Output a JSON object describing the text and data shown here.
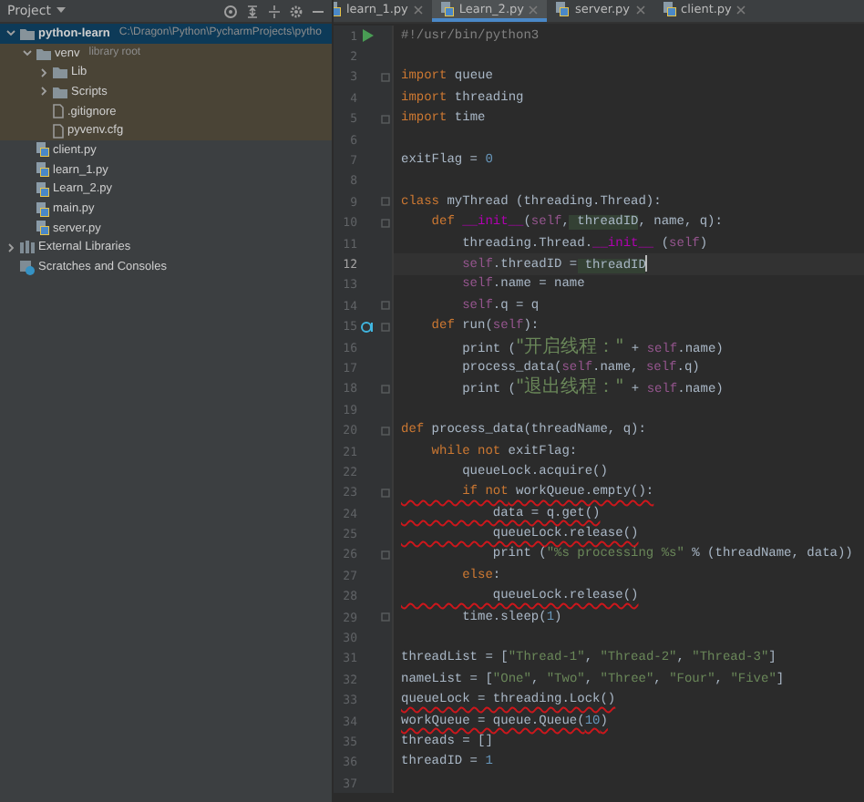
{
  "project_panel": {
    "title": "Project",
    "tree": [
      {
        "label": "python-learn",
        "note": "C:\\Dragon\\Python\\PycharmProjects\\pytho",
        "kind": "root",
        "expanded": true,
        "selected": true,
        "highlighted": false,
        "children": [
          {
            "label": "venv",
            "note": "library root",
            "kind": "folder",
            "expanded": true,
            "selected": false,
            "highlighted": true,
            "children": [
              {
                "label": "Lib",
                "kind": "folder",
                "expanded": false,
                "selected": false,
                "highlighted": true
              },
              {
                "label": "Scripts",
                "kind": "folder",
                "expanded": false,
                "selected": false,
                "highlighted": true
              },
              {
                "label": ".gitignore",
                "kind": "file",
                "selected": false,
                "highlighted": true
              },
              {
                "label": "pyvenv.cfg",
                "kind": "file",
                "selected": false,
                "highlighted": true
              }
            ]
          },
          {
            "label": "client.py",
            "kind": "python",
            "selected": false,
            "highlighted": false
          },
          {
            "label": "learn_1.py",
            "kind": "python",
            "selected": false,
            "highlighted": false
          },
          {
            "label": "Learn_2.py",
            "kind": "python",
            "selected": false,
            "highlighted": false
          },
          {
            "label": "main.py",
            "kind": "python",
            "selected": false,
            "highlighted": false
          },
          {
            "label": "server.py",
            "kind": "python",
            "selected": false,
            "highlighted": false
          }
        ]
      },
      {
        "label": "External Libraries",
        "kind": "library",
        "expanded": false,
        "selected": false,
        "highlighted": false
      },
      {
        "label": "Scratches and Consoles",
        "kind": "scratches",
        "selected": false,
        "highlighted": false
      }
    ]
  },
  "editor": {
    "tabs": [
      {
        "label": "learn_1.py",
        "selected": false
      },
      {
        "label": "Learn_2.py",
        "selected": true
      },
      {
        "label": "server.py",
        "selected": false
      },
      {
        "label": "client.py",
        "selected": false
      }
    ],
    "lines": [
      {
        "number": "1",
        "gutter_icon": {
          "kind": "run"
        },
        "tokens": [
          {
            "text": "#!/usr/bin/python3",
            "kind": "comment"
          }
        ]
      },
      {
        "number": "2"
      },
      {
        "number": "3",
        "fold": true,
        "tokens": [
          {
            "text": "import",
            "kind": "kw"
          },
          {
            "text": " queue",
            "kind": "plain"
          }
        ]
      },
      {
        "number": "4",
        "tokens": [
          {
            "text": "import",
            "kind": "kw"
          },
          {
            "text": " threading",
            "kind": "plain"
          }
        ]
      },
      {
        "number": "5",
        "fold": true,
        "tokens": [
          {
            "text": "import",
            "kind": "kw"
          },
          {
            "text": " time",
            "kind": "plain"
          }
        ]
      },
      {
        "number": "6"
      },
      {
        "number": "7",
        "tokens": [
          {
            "text": "exitFlag = ",
            "kind": "plain"
          },
          {
            "text": "0",
            "kind": "num"
          }
        ]
      },
      {
        "number": "8"
      },
      {
        "number": "9",
        "fold": true,
        "tokens": [
          {
            "text": "class",
            "kind": "kw"
          },
          {
            "text": " myThread (threading.Thread):",
            "kind": "plain"
          }
        ]
      },
      {
        "number": "10",
        "fold": true,
        "tokens": [
          {
            "text": "    def",
            "kind": "kw"
          },
          {
            "text": " __init__",
            "kind": "dunder"
          },
          {
            "text": "(",
            "kind": "plain"
          },
          {
            "text": "self",
            "kind": "self"
          },
          {
            "text": ",",
            "kind": "plain"
          },
          {
            "text": " threadID",
            "kind": "usage"
          },
          {
            "text": ", name, q):",
            "kind": "plain"
          }
        ]
      },
      {
        "number": "11",
        "tokens": [
          {
            "text": "        threading.Thread.",
            "kind": "plain"
          },
          {
            "text": "__init__",
            "kind": "dunder"
          },
          {
            "text": " (",
            "kind": "plain"
          },
          {
            "text": "self",
            "kind": "self"
          },
          {
            "text": ")",
            "kind": "plain"
          }
        ]
      },
      {
        "number": "12",
        "current": true,
        "tokens": [
          {
            "text": "        self",
            "kind": "self"
          },
          {
            "text": ".threadID =",
            "kind": "plain"
          },
          {
            "text": " threadID",
            "kind": "usage"
          }
        ]
      },
      {
        "number": "13",
        "tokens": [
          {
            "text": "        self",
            "kind": "self"
          },
          {
            "text": ".name = name",
            "kind": "plain"
          }
        ]
      },
      {
        "number": "14",
        "fold": true,
        "tokens": [
          {
            "text": "        self",
            "kind": "self"
          },
          {
            "text": ".q = q",
            "kind": "plain"
          }
        ]
      },
      {
        "number": "15",
        "gutter_icon": {
          "kind": "override"
        },
        "fold": true,
        "tokens": [
          {
            "text": "    def",
            "kind": "kw"
          },
          {
            "text": " run(",
            "kind": "plain"
          },
          {
            "text": "self",
            "kind": "self"
          },
          {
            "text": "):",
            "kind": "plain"
          }
        ]
      },
      {
        "number": "16",
        "tokens": [
          {
            "text": "        print (",
            "kind": "plain"
          },
          {
            "text": "\"开启线程：\"",
            "kind": "cjk"
          },
          {
            "text": " + ",
            "kind": "plain"
          },
          {
            "text": "self",
            "kind": "self"
          },
          {
            "text": ".name)",
            "kind": "plain"
          }
        ]
      },
      {
        "number": "17",
        "tokens": [
          {
            "text": "        process_data(",
            "kind": "plain"
          },
          {
            "text": "self",
            "kind": "self"
          },
          {
            "text": ".name, ",
            "kind": "plain"
          },
          {
            "text": "self",
            "kind": "self"
          },
          {
            "text": ".q)",
            "kind": "plain"
          }
        ]
      },
      {
        "number": "18",
        "fold": true,
        "tokens": [
          {
            "text": "        print (",
            "kind": "plain"
          },
          {
            "text": "\"退出线程：\"",
            "kind": "cjk"
          },
          {
            "text": " + ",
            "kind": "plain"
          },
          {
            "text": "self",
            "kind": "self"
          },
          {
            "text": ".name)",
            "kind": "plain"
          }
        ]
      },
      {
        "number": "19"
      },
      {
        "number": "20",
        "fold": true,
        "tokens": [
          {
            "text": "def",
            "kind": "kw"
          },
          {
            "text": " process_data(threadName, q):",
            "kind": "plain"
          }
        ]
      },
      {
        "number": "21",
        "tokens": [
          {
            "text": "    while not",
            "kind": "kw"
          },
          {
            "text": " exitFlag:",
            "kind": "plain"
          }
        ]
      },
      {
        "number": "22",
        "tokens": [
          {
            "text": "        queueLock.acquire()",
            "kind": "plain"
          }
        ]
      },
      {
        "number": "23",
        "fold": true,
        "annotated": true,
        "tokens": [
          {
            "text": "        if not",
            "kind": "kw"
          },
          {
            "text": " workQueue.empty():",
            "kind": "plain"
          }
        ]
      },
      {
        "number": "24",
        "annotated": true,
        "tokens": [
          {
            "text": "            data = q.get()",
            "kind": "plain"
          }
        ]
      },
      {
        "number": "25",
        "annotated": true,
        "tokens": [
          {
            "text": "            queueLock.release()",
            "kind": "plain"
          }
        ]
      },
      {
        "number": "26",
        "fold": true,
        "tokens": [
          {
            "text": "            print (",
            "kind": "plain"
          },
          {
            "text": "\"%s processing %s\"",
            "kind": "str"
          },
          {
            "text": " % (threadName, data))",
            "kind": "plain"
          }
        ]
      },
      {
        "number": "27",
        "tokens": [
          {
            "text": "        else",
            "kind": "kw"
          },
          {
            "text": ":",
            "kind": "plain"
          }
        ]
      },
      {
        "number": "28",
        "annotated": true,
        "tokens": [
          {
            "text": "            queueLock.release()",
            "kind": "plain"
          }
        ]
      },
      {
        "number": "29",
        "fold": true,
        "tokens": [
          {
            "text": "        time.sleep(",
            "kind": "plain"
          },
          {
            "text": "1",
            "kind": "num"
          },
          {
            "text": ")",
            "kind": "plain"
          }
        ]
      },
      {
        "number": "30"
      },
      {
        "number": "31",
        "tokens": [
          {
            "text": "threadList = [",
            "kind": "plain"
          },
          {
            "text": "\"Thread-1\"",
            "kind": "str"
          },
          {
            "text": ", ",
            "kind": "plain"
          },
          {
            "text": "\"Thread-2\"",
            "kind": "str"
          },
          {
            "text": ", ",
            "kind": "plain"
          },
          {
            "text": "\"Thread-3\"",
            "kind": "str"
          },
          {
            "text": "]",
            "kind": "plain"
          }
        ]
      },
      {
        "number": "32",
        "tokens": [
          {
            "text": "nameList = [",
            "kind": "plain"
          },
          {
            "text": "\"One\"",
            "kind": "str"
          },
          {
            "text": ", ",
            "kind": "plain"
          },
          {
            "text": "\"Two\"",
            "kind": "str"
          },
          {
            "text": ", ",
            "kind": "plain"
          },
          {
            "text": "\"Three\"",
            "kind": "str"
          },
          {
            "text": ", ",
            "kind": "plain"
          },
          {
            "text": "\"Four\"",
            "kind": "str"
          },
          {
            "text": ", ",
            "kind": "plain"
          },
          {
            "text": "\"Five\"",
            "kind": "str"
          },
          {
            "text": "]",
            "kind": "plain"
          }
        ]
      },
      {
        "number": "33",
        "annotated": true,
        "tokens": [
          {
            "text": "queueLock = threading.Lock()",
            "kind": "plain"
          }
        ]
      },
      {
        "number": "34",
        "annotated": true,
        "tokens": [
          {
            "text": "workQueue = queue.Queue(",
            "kind": "plain"
          },
          {
            "text": "10",
            "kind": "num"
          },
          {
            "text": ")",
            "kind": "plain"
          }
        ]
      },
      {
        "number": "35",
        "tokens": [
          {
            "text": "threads = []",
            "kind": "plain"
          }
        ]
      },
      {
        "number": "36",
        "tokens": [
          {
            "text": "threadID = ",
            "kind": "plain"
          },
          {
            "text": "1",
            "kind": "num"
          }
        ]
      },
      {
        "number": "37"
      }
    ]
  }
}
